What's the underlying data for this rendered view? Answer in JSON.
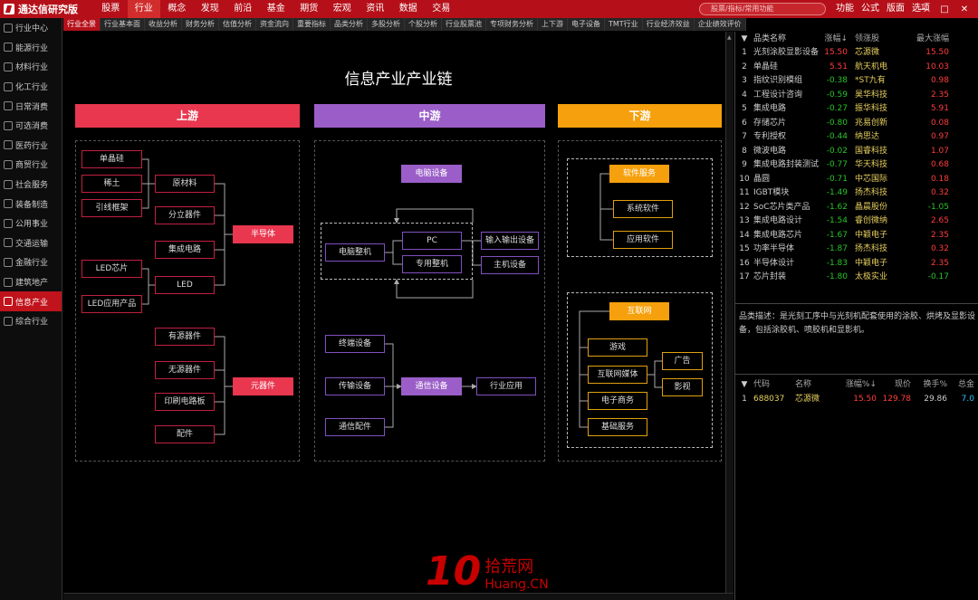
{
  "app": {
    "title": "通达信研究版"
  },
  "nav": [
    "股票",
    "行业",
    "概念",
    "发现",
    "前沿",
    "基金",
    "期货",
    "宏观",
    "资讯",
    "数据",
    "交易"
  ],
  "nav_active": 1,
  "search": {
    "placeholder": "股票/指标/常用功能"
  },
  "topright": [
    "功能",
    "公式",
    "版面",
    "选项"
  ],
  "window_controls": [
    "—",
    "□",
    "✕"
  ],
  "sidebar": [
    {
      "label": "行业中心",
      "icon": "grid-icon"
    },
    {
      "label": "能源行业",
      "icon": "energy-icon"
    },
    {
      "label": "材料行业",
      "icon": "material-icon"
    },
    {
      "label": "化工行业",
      "icon": "flask-icon"
    },
    {
      "label": "日常消费",
      "icon": "coin-icon"
    },
    {
      "label": "可选消费",
      "icon": "cart-icon"
    },
    {
      "label": "医药行业",
      "icon": "medical-icon"
    },
    {
      "label": "商贸行业",
      "icon": "trade-icon"
    },
    {
      "label": "社会服务",
      "icon": "service-icon"
    },
    {
      "label": "装备制造",
      "icon": "gear-icon"
    },
    {
      "label": "公用事业",
      "icon": "utility-icon"
    },
    {
      "label": "交通运输",
      "icon": "transport-icon"
    },
    {
      "label": "金融行业",
      "icon": "finance-icon"
    },
    {
      "label": "建筑地产",
      "icon": "building-icon"
    },
    {
      "label": "信息产业",
      "icon": "chip-icon"
    },
    {
      "label": "综合行业",
      "icon": "misc-icon"
    }
  ],
  "sidebar_active": 14,
  "tabs": [
    "行业全景",
    "行业基本面",
    "收益分析",
    "财务分析",
    "估值分析",
    "资金流向",
    "重要指标",
    "品类分析",
    "多股分析",
    "个股分析",
    "行业股票池",
    "专项财务分析",
    "上下游",
    "电子设备",
    "TMT行业",
    "行业经济效益",
    "企业绩效评价"
  ],
  "tab_active": 0,
  "page_title": "信息产业产业链",
  "sections": {
    "up": "上游",
    "mid": "中游",
    "down": "下游"
  },
  "colors": {
    "up": "#e8374f",
    "mid": "#9b5ec8",
    "down": "#f5a00c",
    "brand": "#b51019"
  },
  "upstream": {
    "materials": [
      "单晶硅",
      "稀土",
      "引线框架"
    ],
    "raw": "原材料",
    "comps": [
      "分立器件",
      "集成电路",
      "LED"
    ],
    "led_in": [
      "LED芯片",
      "LED应用产品"
    ],
    "semi": "半导体",
    "passives": [
      "有源器件",
      "无源器件",
      "印刷电路板",
      "配件"
    ],
    "elem": "元器件"
  },
  "midstream": {
    "computer": "电脑设备",
    "whole": "电脑整机",
    "pc": "PC",
    "special": "专用整机",
    "io": "输入输出设备",
    "host": "主机设备",
    "comm_parts": [
      "终端设备",
      "传输设备",
      "通信配件"
    ],
    "comm": "通信设备",
    "app": "行业应用"
  },
  "downstream": {
    "software": "软件服务",
    "sw_items": [
      "系统软件",
      "应用软件"
    ],
    "internet": "互联网",
    "net_items": [
      "游戏",
      "互联网媒体",
      "电子商务",
      "基础服务"
    ],
    "media_items": [
      "广告",
      "影视"
    ]
  },
  "rank_headers": [
    "",
    "品类名称",
    "涨幅↓",
    "领涨股",
    "最大涨幅"
  ],
  "rank": [
    {
      "i": "1",
      "name": "光刻涂胶显影设备",
      "chg": "15.50",
      "lead": "芯源微",
      "max": "15.50"
    },
    {
      "i": "2",
      "name": "单晶硅",
      "chg": "5.51",
      "lead": "航天机电",
      "max": "10.03"
    },
    {
      "i": "3",
      "name": "指纹识别模组",
      "chg": "-0.38",
      "lead": "*ST九有",
      "max": "0.98"
    },
    {
      "i": "4",
      "name": "工程设计咨询",
      "chg": "-0.59",
      "lead": "昊华科技",
      "max": "2.35"
    },
    {
      "i": "5",
      "name": "集成电路",
      "chg": "-0.27",
      "lead": "振华科技",
      "max": "5.91"
    },
    {
      "i": "6",
      "name": "存储芯片",
      "chg": "-0.80",
      "lead": "兆易创新",
      "max": "0.08"
    },
    {
      "i": "7",
      "name": "专利授权",
      "chg": "-0.44",
      "lead": "纳思达",
      "max": "0.97"
    },
    {
      "i": "8",
      "name": "微波电路",
      "chg": "-0.02",
      "lead": "国睿科技",
      "max": "1.07"
    },
    {
      "i": "9",
      "name": "集成电路封装测试",
      "chg": "-0.77",
      "lead": "华天科技",
      "max": "0.68"
    },
    {
      "i": "10",
      "name": "晶圆",
      "chg": "-0.71",
      "lead": "中芯国际",
      "max": "0.18"
    },
    {
      "i": "11",
      "name": "IGBT模块",
      "chg": "-1.49",
      "lead": "扬杰科技",
      "max": "0.32"
    },
    {
      "i": "12",
      "name": "SoC芯片类产品",
      "chg": "-1.62",
      "lead": "晶晨股份",
      "max": "-1.05"
    },
    {
      "i": "13",
      "name": "集成电路设计",
      "chg": "-1.54",
      "lead": "睿创微纳",
      "max": "2.65"
    },
    {
      "i": "14",
      "name": "集成电路芯片",
      "chg": "-1.67",
      "lead": "中颖电子",
      "max": "2.35"
    },
    {
      "i": "15",
      "name": "功率半导体",
      "chg": "-1.87",
      "lead": "扬杰科技",
      "max": "0.32"
    },
    {
      "i": "16",
      "name": "半导体设计",
      "chg": "-1.83",
      "lead": "中颖电子",
      "max": "2.35"
    },
    {
      "i": "17",
      "name": "芯片封装",
      "chg": "-1.80",
      "lead": "太极实业",
      "max": "-0.17"
    }
  ],
  "description": "品类描述：是光刻工序中与光刻机配套使用的涂胶、烘烤及显影设备，包括涂胶机、喷胶机和显影机。",
  "stock_headers": [
    "",
    "代码",
    "名称",
    "涨幅%↓",
    "现价",
    "换手%",
    "总金"
  ],
  "stocks": [
    {
      "i": "1",
      "code": "688037",
      "name": "芯源微",
      "chg": "15.50",
      "price": "129.78",
      "turn": "29.86",
      "amt": "7.0"
    }
  ],
  "watermark": {
    "big": "10",
    "line1": "拾荒网",
    "line2": "Huang.CN"
  }
}
